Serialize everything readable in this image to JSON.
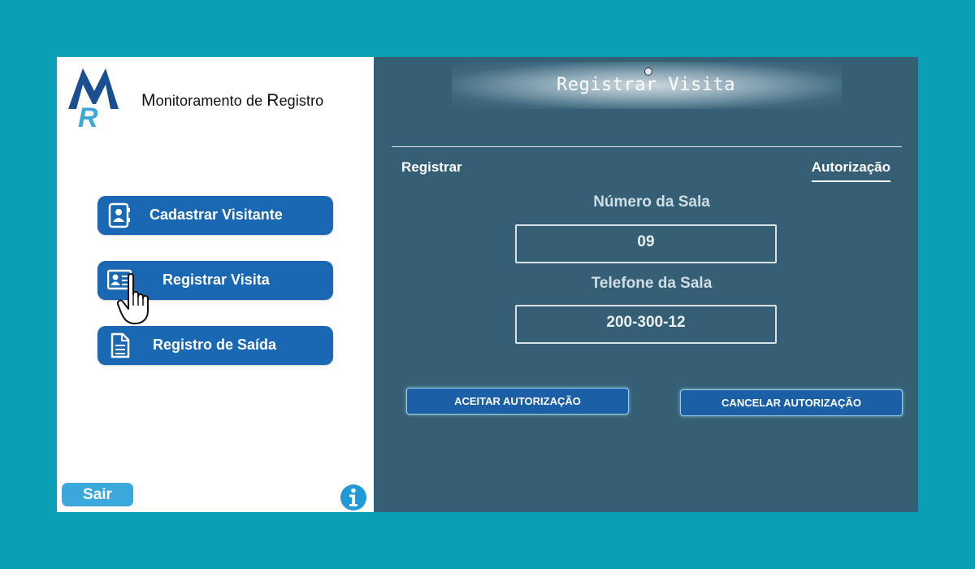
{
  "sidebar": {
    "app_title_parts": [
      "M",
      "onitoramento de ",
      "R",
      "egistro"
    ],
    "nav": [
      {
        "label": "Cadastrar Visitante",
        "icon": "contact-book-icon"
      },
      {
        "label": "Registrar Visita",
        "icon": "id-card-icon"
      },
      {
        "label": "Registro de Saída",
        "icon": "document-icon"
      }
    ],
    "logout_label": "Sair",
    "info_icon": "info-icon",
    "cursor_icon": "hand-pointer-icon"
  },
  "panel": {
    "title": "Registrar Visita",
    "tabs": [
      {
        "label": "Registrar",
        "active": false
      },
      {
        "label": "Autorização",
        "active": true
      }
    ],
    "room_number_label": "Número da Sala",
    "room_number_value": "09",
    "room_phone_label": "Telefone da Sala",
    "room_phone_value": "200-300-12",
    "accept_button": "ACEITAR AUTORIZAÇÃO",
    "cancel_button": "CANCELAR AUTORIZAÇÃO"
  },
  "colors": {
    "background": "#0a9fb5",
    "sidebar": "#ffffff",
    "panel": "#355f75",
    "nav_button": "#1a68b3",
    "logout_button": "#3aa8da",
    "action_button": "#1b5fa7"
  }
}
